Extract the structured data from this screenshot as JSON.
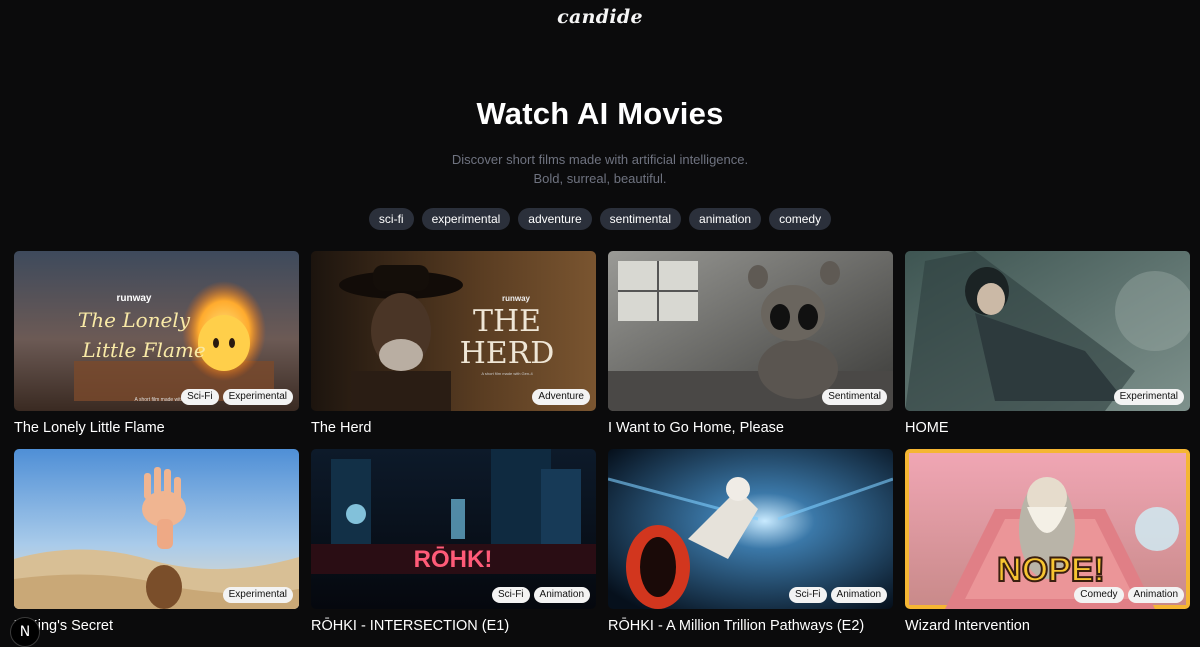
{
  "header": {
    "logo": "candide"
  },
  "hero": {
    "title": "Watch AI Movies",
    "subtitle_line1": "Discover short films made with artificial intelligence.",
    "subtitle_line2": "Bold, surreal, beautiful."
  },
  "tags": [
    "sci-fi",
    "experimental",
    "adventure",
    "sentimental",
    "animation",
    "comedy"
  ],
  "movies": [
    {
      "title": "The Lonely Little Flame",
      "badges": [
        "Sci-Fi",
        "Experimental"
      ],
      "poster_brand": "runway",
      "poster_line1": "The Lonely",
      "poster_line2": "Little Flame",
      "poster_caption": "A short film made with"
    },
    {
      "title": "The Herd",
      "badges": [
        "Adventure"
      ],
      "poster_brand": "runway",
      "poster_line1": "THE",
      "poster_line2": "HERD",
      "poster_caption": "A short film made with Gen-4"
    },
    {
      "title": "I Want to Go Home, Please",
      "badges": [
        "Sentimental"
      ]
    },
    {
      "title": "HOME",
      "badges": [
        "Experimental"
      ]
    },
    {
      "title": "'s King's Secret",
      "badges": [
        "Experimental"
      ]
    },
    {
      "title": "RŌHKI - INTERSECTION (E1)",
      "badges": [
        "Sci-Fi",
        "Animation"
      ],
      "poster_text": "RŌHK!"
    },
    {
      "title": "RŌHKI - A Million Trillion Pathways (E2)",
      "badges": [
        "Sci-Fi",
        "Animation"
      ]
    },
    {
      "title": "Wizard Intervention",
      "badges": [
        "Comedy",
        "Animation"
      ],
      "poster_text": "NOPE!"
    }
  ],
  "dev_badge": "N",
  "colors": {
    "background": "#0b0b0c",
    "tag_bg": "#2b303b",
    "highlight_border": "#f5b633"
  }
}
